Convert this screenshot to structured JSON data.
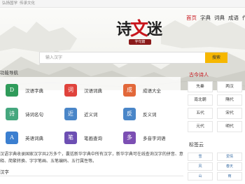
{
  "topbar": {
    "site": "弘扬国学",
    "tagline": "传承文化"
  },
  "logo": {
    "chars": [
      "诗",
      "文",
      "迷"
    ],
    "sub": "字句篇"
  },
  "nav": {
    "items": [
      "首页",
      "字典",
      "词典",
      "成语",
      "作文",
      "诗词",
      "古文"
    ],
    "active_index": 0
  },
  "search": {
    "placeholder": "输入汉字",
    "button": "搜索"
  },
  "functions": {
    "title": "功能导航",
    "items": [
      {
        "label": "汉语字典",
        "glyph": "D",
        "color": "#2f9b5a"
      },
      {
        "label": "汉语词典",
        "glyph": "词",
        "color": "#e0433c"
      },
      {
        "label": "成语大全",
        "glyph": "成",
        "color": "#e2683a"
      },
      {
        "label": "诗词名句",
        "glyph": "诗",
        "color": "#45a77e"
      },
      {
        "label": "近义词",
        "glyph": "近",
        "color": "#4a86c8"
      },
      {
        "label": "反义词",
        "glyph": "反",
        "color": "#4a86c8"
      },
      {
        "label": "英语词典",
        "glyph": "A",
        "color": "#3b7fd0"
      },
      {
        "label": "笔画查询",
        "glyph": "笔",
        "color": "#6d4fb3"
      },
      {
        "label": "多音字词语",
        "glyph": "多",
        "color": "#7c4fb3"
      }
    ]
  },
  "poets": {
    "title": "古今诗人",
    "items": [
      "先秦",
      "两汉",
      "南北朝",
      "隋代",
      "五代",
      "宋代",
      "元代",
      "明代"
    ]
  },
  "description": {
    "line1": "汉语字典收录国家汉字共2万多个，囊括新华字典中所有汉字，新华字典可在线查询汉字的拼音、意思解",
    "line2": "释、简繁转换、字字笔画、五笔编码、五行属性等。"
  },
  "subheading": "汉字",
  "tags": {
    "title": "标签云",
    "items": [
      "雪",
      "爱情",
      "风",
      "春天",
      "山",
      "雨",
      "中秋",
      "月亮"
    ]
  }
}
